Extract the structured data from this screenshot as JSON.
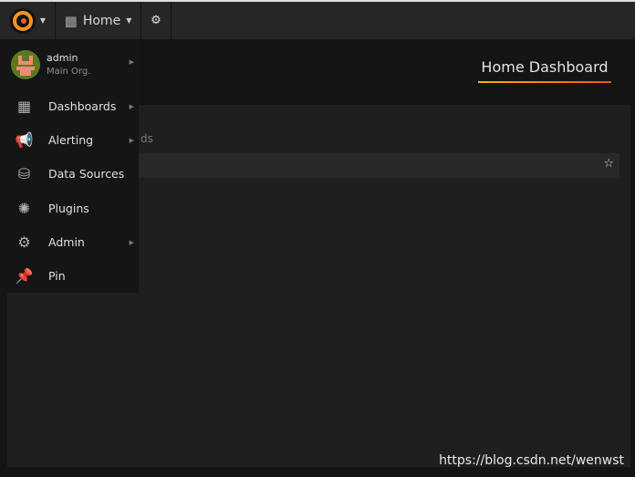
{
  "topbar": {
    "home_label": "Home",
    "logo_icon": "grafana-logo-icon",
    "settings_icon": "gear-icon"
  },
  "user": {
    "name": "admin",
    "org": "Main Org."
  },
  "menu": [
    {
      "label": "Dashboards",
      "icon": "dashboards-icon",
      "submenu": true
    },
    {
      "label": "Alerting",
      "icon": "megaphone-icon",
      "submenu": true
    },
    {
      "label": "Data Sources",
      "icon": "database-icon",
      "submenu": false
    },
    {
      "label": "Plugins",
      "icon": "plugins-icon",
      "submenu": false
    },
    {
      "label": "Admin",
      "icon": "cogs-icon",
      "submenu": true
    },
    {
      "label": "Pin",
      "icon": "pin-icon",
      "submenu": false
    }
  ],
  "main": {
    "title": "Home Dashboard",
    "partial_heading": "ds"
  },
  "watermark": "https://blog.csdn.net/wenwst",
  "colors": {
    "accent_start": "#ffb100",
    "accent_end": "#e35a1b"
  }
}
